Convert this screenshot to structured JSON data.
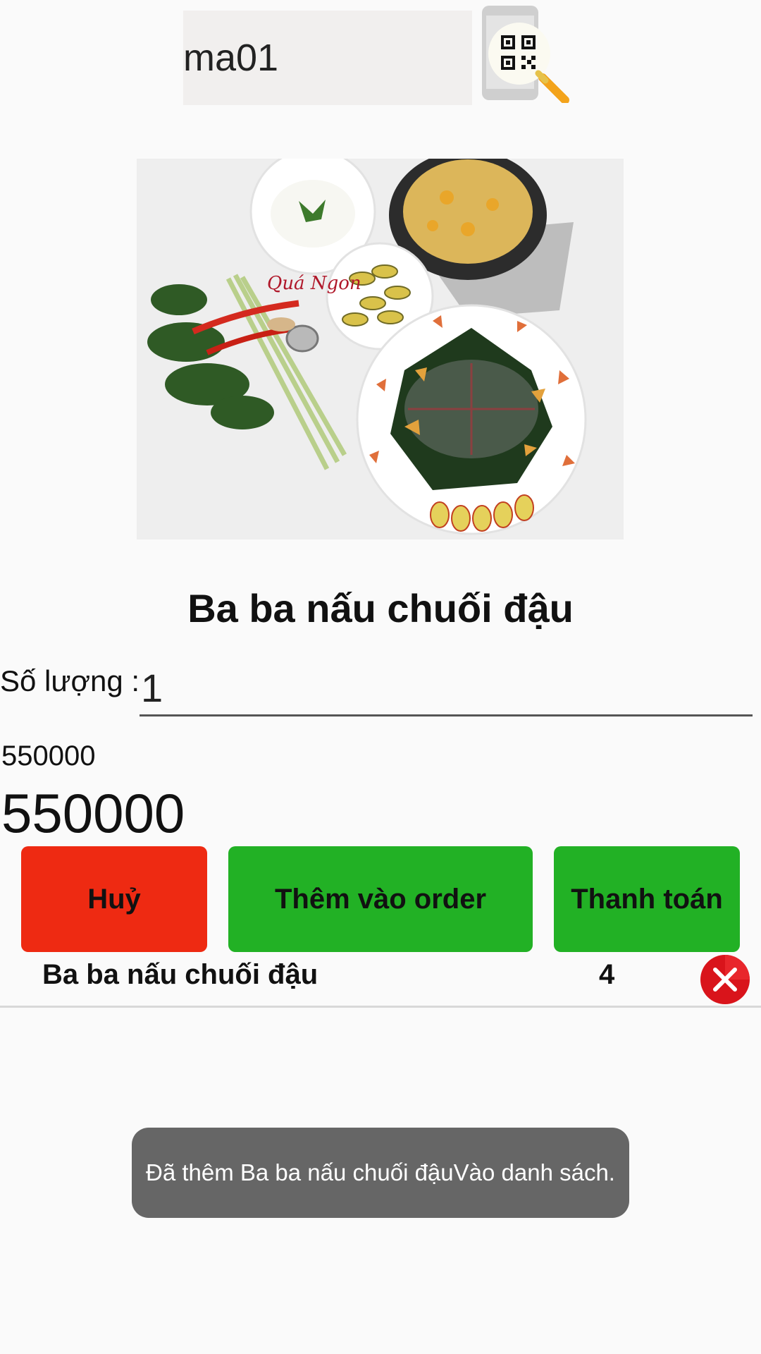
{
  "search": {
    "code_value": "ma01",
    "scan_icon": "qr-scan-icon"
  },
  "dish": {
    "photo_icon": "dish-photo",
    "title": "Ba ba nấu chuối đậu"
  },
  "quantity": {
    "label": "Số lượng :",
    "value": "1"
  },
  "price": {
    "unit": "550000",
    "total": "550000"
  },
  "buttons": {
    "cancel": "Huỷ",
    "add": "Thêm vào order",
    "pay": "Thanh toán"
  },
  "order_list": [
    {
      "name": "Ba ba nấu chuối đậu",
      "qty": "4"
    }
  ],
  "toast": {
    "message": "Đã thêm Ba ba nấu chuối đậuVào danh sách."
  },
  "colors": {
    "cancel": "#ee2a12",
    "add": "#22b125",
    "pay": "#22b125",
    "remove": "#d9141b"
  }
}
